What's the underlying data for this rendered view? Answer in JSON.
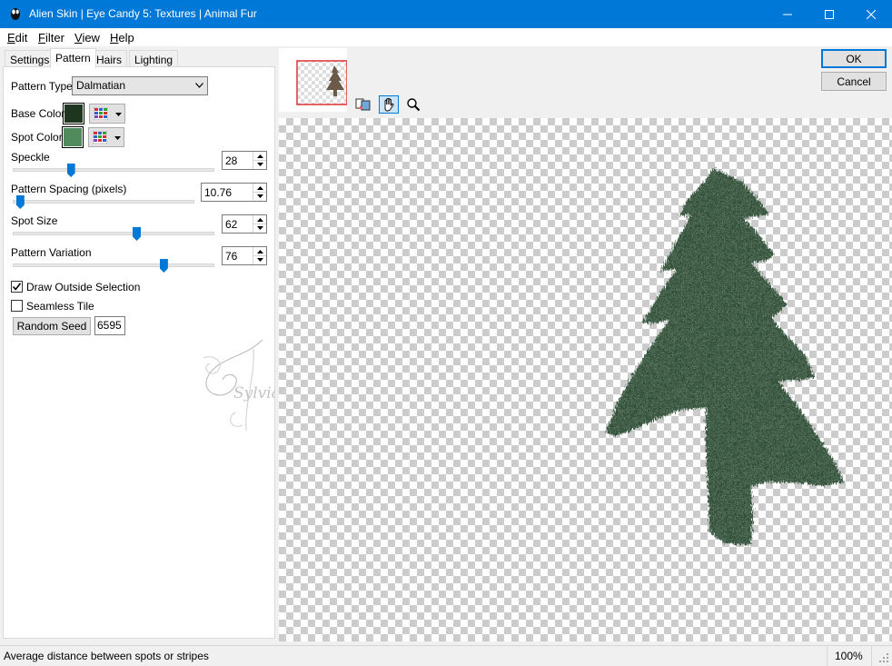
{
  "window": {
    "title": "Alien Skin | Eye Candy 5: Textures | Animal Fur",
    "minimize_icon": "minimize-icon",
    "maximize_icon": "maximize-icon",
    "close_icon": "close-icon"
  },
  "menu": {
    "items": [
      {
        "label": "Edit",
        "accel": "E",
        "rest": "dit"
      },
      {
        "label": "Filter",
        "accel": "F",
        "rest": "ilter"
      },
      {
        "label": "View",
        "accel": "V",
        "rest": "iew"
      },
      {
        "label": "Help",
        "accel": "H",
        "rest": "elp"
      }
    ]
  },
  "tabs": [
    "Settings",
    "Pattern",
    "Hairs",
    "Lighting"
  ],
  "active_tab": "Pattern",
  "pattern": {
    "type_label": "Pattern Type:",
    "type_value": "Dalmatian",
    "base_color_label": "Base Color",
    "base_color": "#1e3520",
    "spot_color_label": "Spot Color",
    "spot_color": "#4f8b5d",
    "speckle_label": "Speckle",
    "speckle_value": "28",
    "speckle_level": 0.28,
    "spacing_label": "Pattern Spacing (pixels)",
    "spacing_value": "10.76",
    "spacing_level": 0.02,
    "spot_size_label": "Spot Size",
    "spot_size_value": "62",
    "spot_size_level": 0.62,
    "variation_label": "Pattern Variation",
    "variation_value": "76",
    "variation_level": 0.76,
    "draw_outside_label": "Draw Outside Selection",
    "draw_outside_checked": true,
    "seamless_label": "Seamless Tile",
    "seamless_checked": false,
    "random_seed_label": "Random Seed",
    "random_seed_value": "6595"
  },
  "buttons": {
    "ok": "OK",
    "cancel": "Cancel"
  },
  "watermark": "Sylviane",
  "preview": {
    "tree_color": "#1f3d26",
    "nav_tree_color": "#6b5a4a",
    "nav_frame_color": "#e04040"
  },
  "status": {
    "message": "Average distance between spots or stripes",
    "zoom": "100%"
  }
}
